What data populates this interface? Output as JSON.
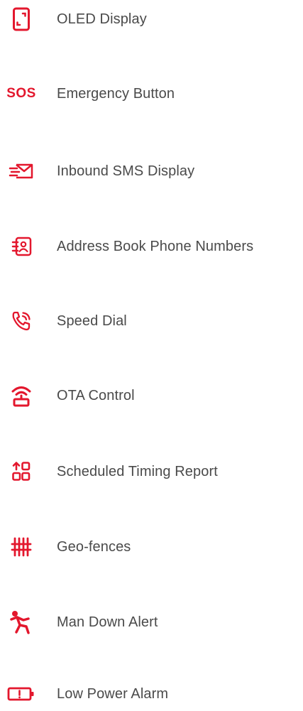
{
  "colors": {
    "accent": "#e3172d",
    "text": "#4a4a4a",
    "background": "#ffffff"
  },
  "features": [
    {
      "label": "OLED Display",
      "icon": "phone-display-icon"
    },
    {
      "label": "Emergency Button",
      "icon": "sos-icon",
      "icon_text": "SOS"
    },
    {
      "label": "Inbound SMS Display",
      "icon": "envelope-icon"
    },
    {
      "label": "Address Book Phone Numbers",
      "icon": "contact-book-icon"
    },
    {
      "label": "Speed Dial",
      "icon": "phone-call-icon"
    },
    {
      "label": "OTA Control",
      "icon": "wireless-signal-icon"
    },
    {
      "label": "Scheduled Timing Report",
      "icon": "scheduled-grid-icon"
    },
    {
      "label": "Geo-fences",
      "icon": "fence-icon"
    },
    {
      "label": "Man Down Alert",
      "icon": "falling-person-icon"
    },
    {
      "label": "Low Power Alarm",
      "icon": "low-battery-icon"
    }
  ]
}
